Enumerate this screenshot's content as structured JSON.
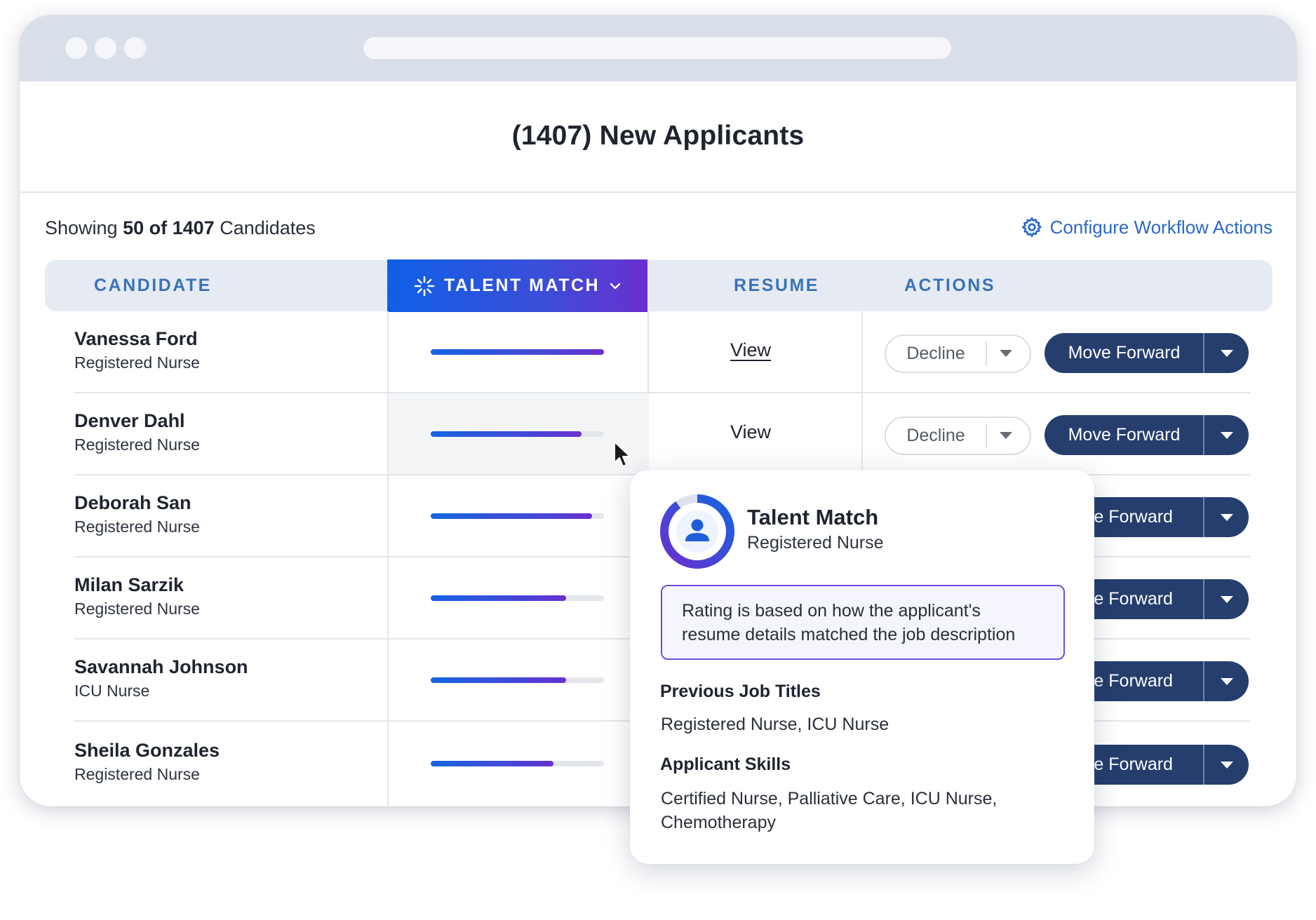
{
  "page": {
    "title": "(1407) New Applicants",
    "showing_prefix": "Showing",
    "showing_count": "50 of 1407",
    "showing_suffix": "Candidates",
    "configure_label": "Configure Workflow Actions",
    "configure_icon": "gear-icon"
  },
  "table": {
    "headers": {
      "candidate": "CANDIDATE",
      "talent_match": "TALENT MATCH",
      "resume": "RESUME",
      "actions": "ACTIONS"
    },
    "rows": [
      {
        "name": "Vanessa Ford",
        "role": "Registered Nurse",
        "match": 1.0,
        "resume": "View",
        "decline": "Decline",
        "forward": "Move Forward",
        "forward_visible": "Move Forward"
      },
      {
        "name": "Denver Dahl",
        "role": "Registered Nurse",
        "match": 0.87,
        "resume": "View",
        "decline": "Decline",
        "forward": "Move Forward",
        "forward_visible": "Move Forward"
      },
      {
        "name": "Deborah San",
        "role": "Registered Nurse",
        "match": 0.93,
        "forward_visible": "ove Forward"
      },
      {
        "name": "Milan Sarzik",
        "role": "Registered Nurse",
        "match": 0.78,
        "forward_visible": "ove Forward"
      },
      {
        "name": "Savannah Johnson",
        "role": "ICU Nurse",
        "match": 0.78,
        "forward_visible": "ove Forward"
      },
      {
        "name": "Sheila Gonzales",
        "role": "Registered Nurse",
        "match": 0.71,
        "forward_visible": "ove Forward"
      }
    ]
  },
  "popover": {
    "title": "Talent Match",
    "subtitle": "Registered Nurse",
    "ring_fraction": 0.9,
    "note": "Rating is based on how the applicant's resume details matched the job description",
    "prev_titles_heading": "Previous Job Titles",
    "prev_titles": "Registered Nurse, ICU Nurse",
    "skills_heading": "Applicant Skills",
    "skills": "Certified Nurse, Palliative Care, ICU Nurse, Chemotherapy"
  },
  "colors": {
    "accent_blue": "#2a68c7",
    "header_text": "#3a72b8",
    "primary_button": "#253e6d",
    "gradient_start": "#0f5fe6",
    "gradient_end": "#6a2fcf"
  }
}
